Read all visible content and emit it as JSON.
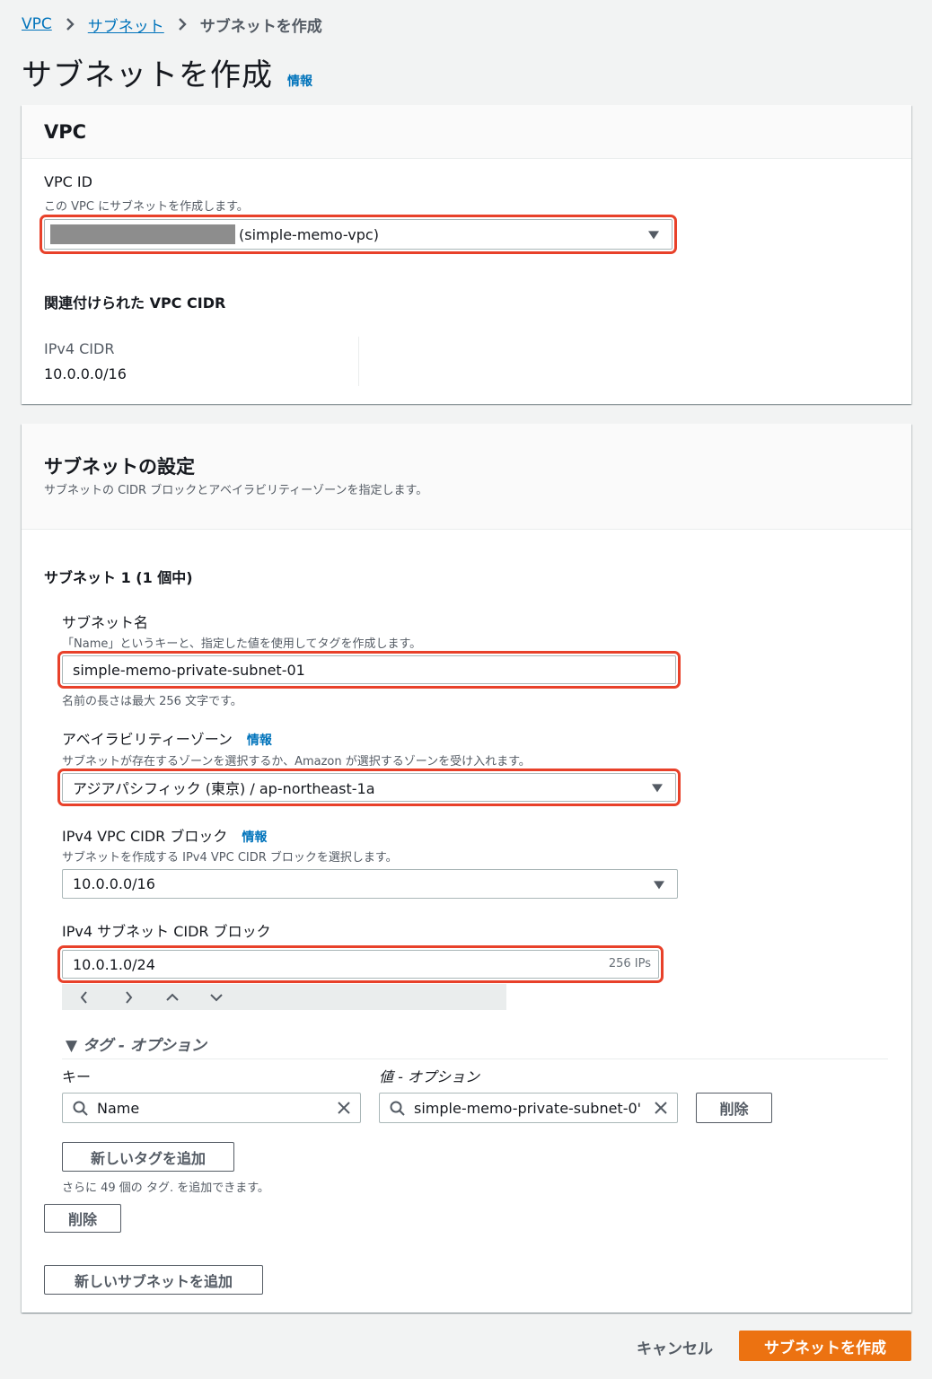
{
  "breadcrumb": {
    "items": [
      "VPC",
      "サブネット"
    ],
    "current": "サブネットを作成"
  },
  "page": {
    "title": "サブネットを作成",
    "info": "情報"
  },
  "vpc_panel": {
    "header": "VPC",
    "vpc_id_label": "VPC ID",
    "vpc_id_desc": "この VPC にサブネットを作成します。",
    "vpc_id_value": "(simple-memo-vpc)",
    "assoc_cidr_label": "関連付けられた VPC CIDR",
    "ipv4_cidr_label": "IPv4 CIDR",
    "ipv4_cidr_value": "10.0.0.0/16"
  },
  "subnet_panel": {
    "header": "サブネットの設定",
    "header_desc": "サブネットの CIDR ブロックとアベイラビリティーゾーンを指定します。",
    "subnet_count_label": "サブネット 1 (1 個中)",
    "name_label": "サブネット名",
    "name_desc": "「Name」というキーと、指定した値を使用してタグを作成します。",
    "name_value": "simple-memo-private-subnet-01",
    "name_hint": "名前の長さは最大 256 文字です。",
    "az_label": "アベイラビリティーゾーン",
    "az_info": "情報",
    "az_desc": "サブネットが存在するゾーンを選択するか、Amazon が選択するゾーンを受け入れます。",
    "az_value": "アジアパシフィック (東京) / ap-northeast-1a",
    "vpc_cidr_label": "IPv4 VPC CIDR ブロック",
    "vpc_cidr_info": "情報",
    "vpc_cidr_desc": "サブネットを作成する IPv4 VPC CIDR ブロックを選択します。",
    "vpc_cidr_value": "10.0.0.0/16",
    "subnet_cidr_label": "IPv4 サブネット CIDR ブロック",
    "subnet_cidr_value": "10.0.1.0/24",
    "subnet_cidr_ips": "256 IPs",
    "nav_arrows": [
      "‹",
      "›",
      "⌃",
      "⌄"
    ],
    "tags_toggle": "▼ タグ - オプション",
    "tag_key_label": "キー",
    "tag_value_label": "値 - オプション",
    "tag_key_value": "Name",
    "tag_value_value": "simple-memo-private-subnet-0'",
    "tag_remove": "削除",
    "add_tag": "新しいタグを追加",
    "tag_remaining": "さらに 49 個の タグ. を追加できます。",
    "remove_subnet": "削除",
    "add_subnet": "新しいサブネットを追加"
  },
  "footer": {
    "cancel": "キャンセル",
    "create": "サブネットを作成"
  },
  "colors": {
    "link": "#0073bb",
    "primary": "#ec7211",
    "highlight": "#e8412a"
  }
}
